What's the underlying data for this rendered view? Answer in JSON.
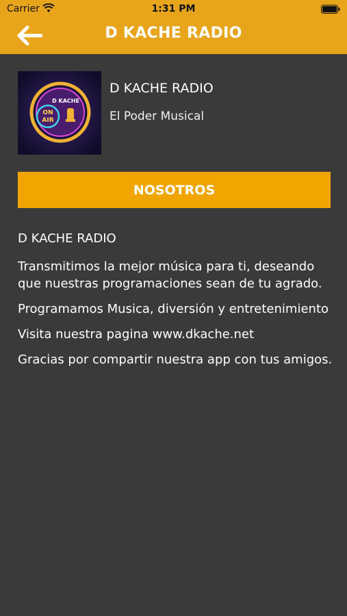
{
  "status_bar": {
    "carrier": "Carrier",
    "time": "1:31 PM"
  },
  "nav": {
    "title": "D KACHE RADIO",
    "back_icon": "arrow-left-icon"
  },
  "station": {
    "name": "D KACHE RADIO",
    "slogan": "El Poder Musical",
    "logo": {
      "brand_text": "D KACHE",
      "on_air_text_1": "ON",
      "on_air_text_2": "AIR"
    }
  },
  "tab": {
    "label": "NOSOTROS"
  },
  "about": {
    "title": "D KACHE RADIO",
    "paragraphs": [
      "Transmitimos la mejor música para ti, deseando que nuestras programaciones sean de tu agrado.",
      "Programamos Musica, diversión y entretenimiento",
      "Visita nuestra pagina www.dkache.net",
      "Gracias por compartir nuestra app con tus amigos."
    ]
  },
  "colors": {
    "accent": "#e8a51b",
    "button": "#f0a500",
    "background": "#3a3a3a",
    "text": "#ffffff"
  }
}
